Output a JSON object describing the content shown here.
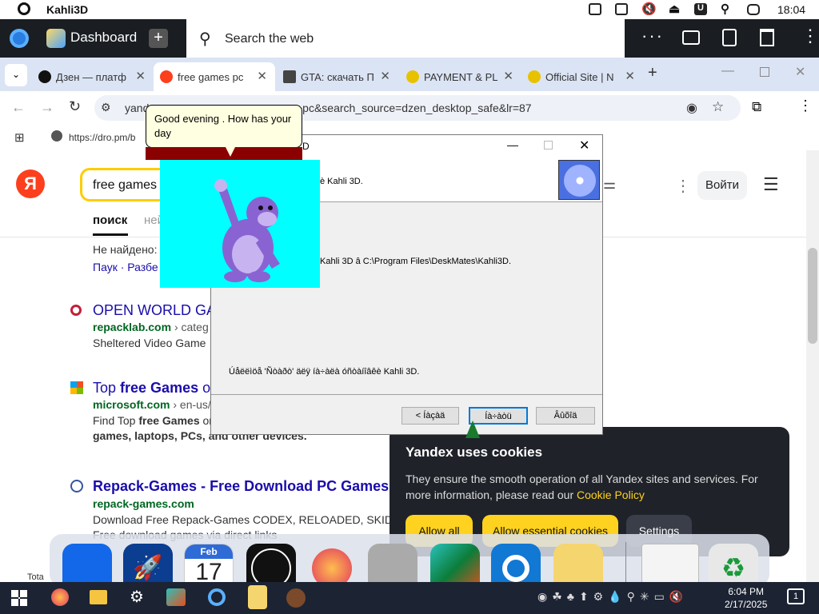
{
  "statusbar": {
    "app_title": "Kahli3D",
    "time": "18:04"
  },
  "appbar": {
    "dashboard_label": "Dashboard",
    "search_placeholder": "Search the web"
  },
  "tabs": [
    {
      "label": "Дзен — платф",
      "fav_color": "#111111"
    },
    {
      "label": "free games pc",
      "fav_color": "#fc3f1d"
    },
    {
      "label": "GTA: скачать П",
      "fav_color": "#444444"
    },
    {
      "label": "PAYMENT & PL",
      "fav_color": "#e8c200"
    },
    {
      "label": "Official Site | N",
      "fav_color": "#e8c200"
    }
  ],
  "address": {
    "url_left": "yand",
    "url_right": "+pc&search_source=dzen_desktop_safe&lr=87"
  },
  "bookmarks": {
    "item1": "https://dro.pm/b"
  },
  "yandex": {
    "logo": "Я",
    "query": "free games",
    "tab_search": "поиск",
    "tab_images": "ней",
    "login": "Войти",
    "not_found": "Не найдено:",
    "related_links": "Паук · Разбе"
  },
  "results": [
    {
      "title": "OPEN WORLD GA",
      "host": "repacklab.com",
      "host_tail": " › categ",
      "snippet": "Sheltered Video Game"
    },
    {
      "title_pre": "Top ",
      "title_bold": "free Games",
      "title_post": " o",
      "host": "microsoft.com",
      "host_tail": " › en-us/",
      "snippet1_pre": "Find Top ",
      "snippet1_bold": "free Games",
      "snippet1_post": " or",
      "snippet2": "games, laptops, PCs, and other devices."
    },
    {
      "title": "Repack-Games - Free Download PC Games",
      "host": "repack-games.com",
      "snippet": "Download Free Repack-Games CODEX, RELOADED, SKID",
      "snippet2": "Free download games via direct links"
    }
  ],
  "cookie": {
    "title": "Yandex uses cookies",
    "text_pre": "They ensure the smooth operation of all Yandex sites and services. For more information, please read our ",
    "link": "Cookie Policy",
    "allow_all": "Allow all",
    "allow_essential": "Allow essential cookies",
    "settings": "Settings"
  },
  "dialog": {
    "title": "D",
    "header_text": "è Kahli 3D.",
    "install_path": "Kahli 3D â C:\\Program Files\\DeskMates\\Kahli3D.",
    "bottom_text": "Úåëëìöå 'Ñòàðò' äëÿ íà÷àëà óñòàíîâêè Kahli 3D.",
    "btn_back": "< Íàçàä",
    "btn_next": "Íà÷àòü",
    "btn_cancel": "Âûõîä"
  },
  "bonzi": {
    "bubble": "Good evening . How has your day"
  },
  "dock": {
    "calendar_month": "Feb",
    "calendar_day": "17"
  },
  "taskbar": {
    "time": "6:04 PM",
    "date": "2/17/2025",
    "notif": "1",
    "partial_label": "Tota"
  }
}
